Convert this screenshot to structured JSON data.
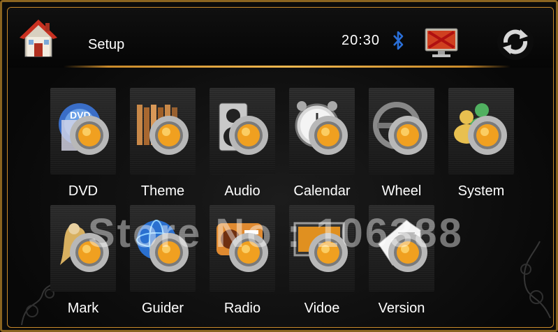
{
  "header": {
    "title": "Setup",
    "clock": "20:30"
  },
  "icons": {
    "home": "home-icon",
    "bluetooth": "bluetooth-icon",
    "monitor_off": "monitor-off-icon",
    "refresh": "refresh-icon"
  },
  "menu": {
    "row1": [
      {
        "label": "DVD",
        "icon": "dvd-icon"
      },
      {
        "label": "Theme",
        "icon": "theme-icon"
      },
      {
        "label": "Audio",
        "icon": "audio-icon"
      },
      {
        "label": "Calendar",
        "icon": "calendar-icon"
      },
      {
        "label": "Wheel",
        "icon": "wheel-icon"
      },
      {
        "label": "System",
        "icon": "system-icon"
      }
    ],
    "row2": [
      {
        "label": "Mark",
        "icon": "mark-icon"
      },
      {
        "label": "Guider",
        "icon": "guider-icon"
      },
      {
        "label": "Radio",
        "icon": "radio-icon"
      },
      {
        "label": "Vidoe",
        "icon": "video-icon"
      },
      {
        "label": "Version",
        "icon": "version-icon"
      }
    ]
  },
  "watermark": "Store No : 106388",
  "colors": {
    "frame_gold": "#c98a2a",
    "gear_orange": "#f0a020",
    "bluetooth_blue": "#2a6fd8"
  }
}
